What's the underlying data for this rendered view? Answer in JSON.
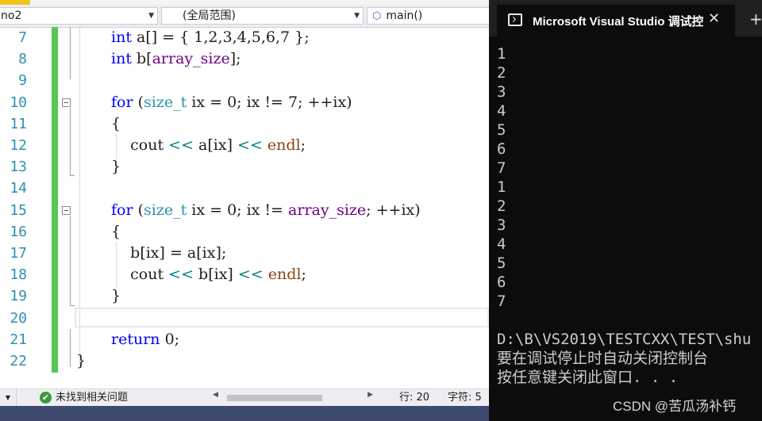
{
  "editor": {
    "navbar": {
      "project_combo": "no2",
      "scope_combo": "(全局范围)",
      "function_combo": "main()"
    },
    "line_numbers": [
      "7",
      "8",
      "9",
      "10",
      "11",
      "12",
      "13",
      "14",
      "15",
      "16",
      "17",
      "18",
      "19",
      "20",
      "21",
      "22"
    ],
    "code_lines": [
      [
        {
          "t": "int",
          "c": "kw"
        },
        {
          "t": " a[] = { 1,2,3,4,5,6,7 };",
          "c": ""
        }
      ],
      [
        {
          "t": "int",
          "c": "kw"
        },
        {
          "t": " b[",
          "c": ""
        },
        {
          "t": "array_size",
          "c": "macro"
        },
        {
          "t": "];",
          "c": ""
        }
      ],
      [],
      [
        {
          "t": "for",
          "c": "kw"
        },
        {
          "t": " (",
          "c": ""
        },
        {
          "t": "size_t",
          "c": "ty"
        },
        {
          "t": " ix = 0; ix != 7; ++ix)",
          "c": ""
        }
      ],
      [
        {
          "t": "{",
          "c": ""
        }
      ],
      [
        {
          "t": "    cout ",
          "c": ""
        },
        {
          "t": "<<",
          "c": "op"
        },
        {
          "t": " a[ix] ",
          "c": ""
        },
        {
          "t": "<<",
          "c": "op"
        },
        {
          "t": " ",
          "c": ""
        },
        {
          "t": "endl",
          "c": "fnm"
        },
        {
          "t": ";",
          "c": ""
        }
      ],
      [
        {
          "t": "}",
          "c": ""
        }
      ],
      [],
      [
        {
          "t": "for",
          "c": "kw"
        },
        {
          "t": " (",
          "c": ""
        },
        {
          "t": "size_t",
          "c": "ty"
        },
        {
          "t": " ix = 0; ix != ",
          "c": ""
        },
        {
          "t": "array_size",
          "c": "macro"
        },
        {
          "t": "; ++ix)",
          "c": ""
        }
      ],
      [
        {
          "t": "{",
          "c": ""
        }
      ],
      [
        {
          "t": "    b[ix] = a[ix];",
          "c": ""
        }
      ],
      [
        {
          "t": "    cout ",
          "c": ""
        },
        {
          "t": "<<",
          "c": "op"
        },
        {
          "t": " b[ix] ",
          "c": ""
        },
        {
          "t": "<<",
          "c": "op"
        },
        {
          "t": " ",
          "c": ""
        },
        {
          "t": "endl",
          "c": "fnm"
        },
        {
          "t": ";",
          "c": ""
        }
      ],
      [
        {
          "t": "}",
          "c": ""
        }
      ],
      [],
      [
        {
          "t": "return",
          "c": "kw"
        },
        {
          "t": " 0;",
          "c": ""
        }
      ],
      [
        {
          "t": "}",
          "c": ""
        }
      ]
    ],
    "code_indents": [
      44,
      44,
      44,
      44,
      44,
      44,
      44,
      44,
      44,
      44,
      44,
      44,
      44,
      44,
      44,
      0
    ],
    "status": {
      "issues": "未找到相关问题",
      "row": "行: 20",
      "col": "字符: 5"
    }
  },
  "console": {
    "title": "Microsoft Visual Studio 调试控制台",
    "close_icon": "close-icon",
    "new_tab_icon": "plus-icon",
    "output_lines": [
      "1",
      "2",
      "3",
      "4",
      "5",
      "6",
      "7",
      "1",
      "2",
      "3",
      "4",
      "5",
      "6",
      "7",
      "",
      "D:\\B\\VS2019\\TESTCXX\\TEST\\shu",
      "要在调试停止时自动关闭控制台",
      "按任意键关闭此窗口. . ."
    ]
  },
  "watermark": "CSDN @苦瓜汤补钙"
}
